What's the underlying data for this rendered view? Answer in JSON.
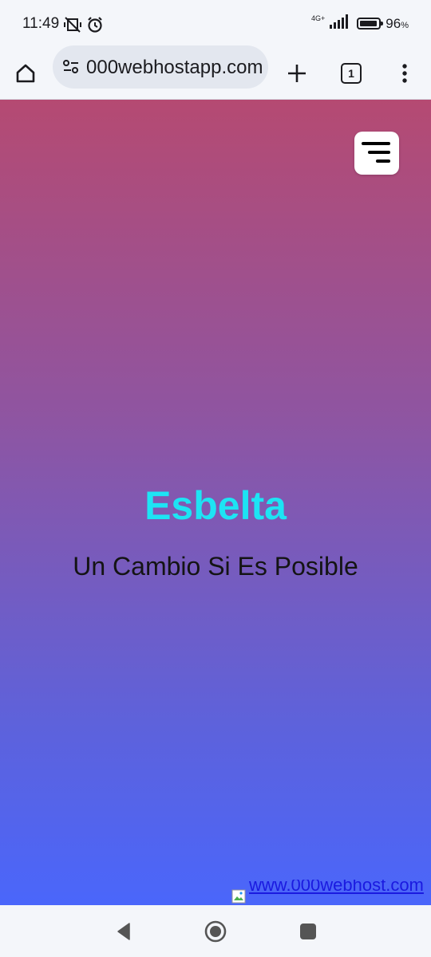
{
  "status_bar": {
    "time": "11:49",
    "network_label": "4G+",
    "battery_percent": "96",
    "battery_unit": "%"
  },
  "browser": {
    "url": "000webhostapp.com",
    "tab_count": "1"
  },
  "page": {
    "title": "Esbelta",
    "subtitle": "Un Cambio Si Es Posible",
    "host_link": "www.000webhost.com",
    "colors": {
      "gradient_top": "#b54a72",
      "gradient_bottom": "#4a66fb",
      "title": "#1de4f4"
    }
  },
  "icons": {
    "status": [
      "vibrate-off-icon",
      "alarm-icon",
      "signal-icon",
      "battery-icon"
    ],
    "toolbar": [
      "home-icon",
      "site-settings-icon",
      "new-tab-icon",
      "tab-switcher-icon",
      "more-menu-icon"
    ],
    "nav": [
      "back-icon",
      "home-nav-icon",
      "recents-icon"
    ]
  }
}
